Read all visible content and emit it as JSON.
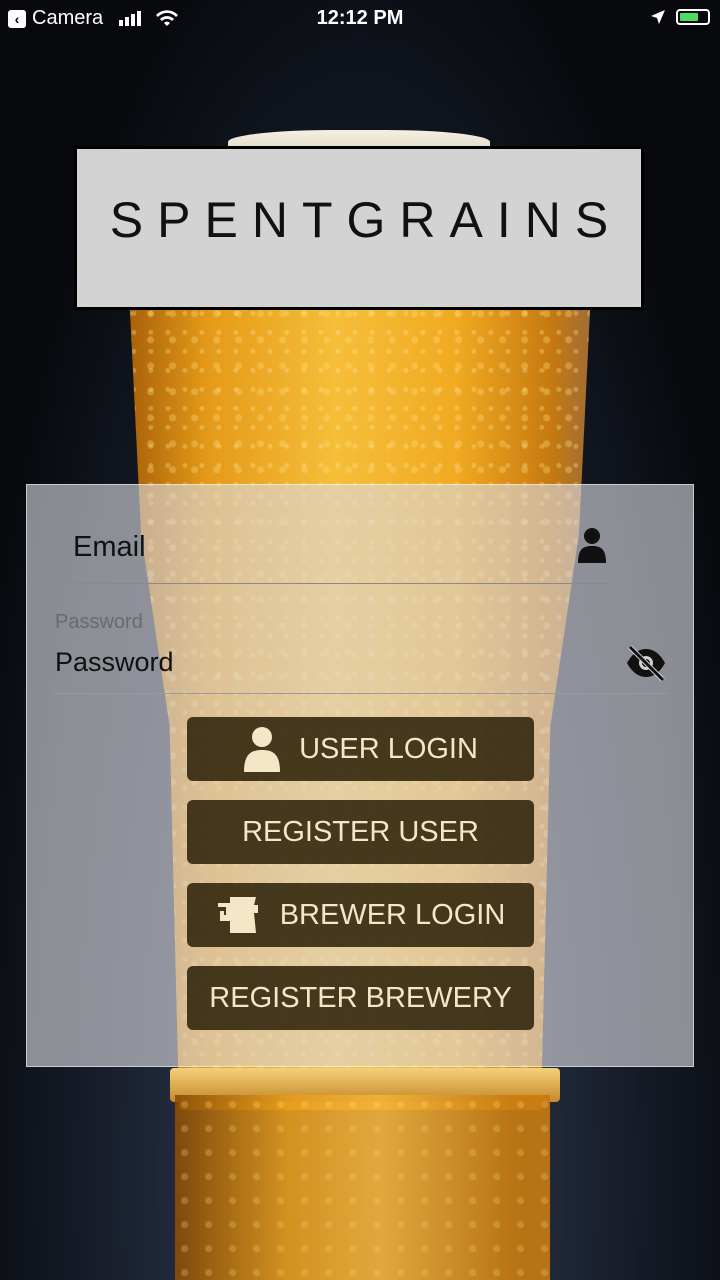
{
  "status_bar": {
    "back_app": "Camera",
    "time": "12:12 PM",
    "icons": [
      "back-icon",
      "signal-icon",
      "wifi-icon",
      "location-icon",
      "battery-icon"
    ]
  },
  "logo": {
    "text": "SPENTGRAINS"
  },
  "form": {
    "email_placeholder": "Email",
    "password_label": "Password",
    "password_placeholder": "Password"
  },
  "buttons": {
    "user_login": "USER LOGIN",
    "register_user": "REGISTER USER",
    "brewer_login": "BREWER LOGIN",
    "register_brewery": "REGISTER BREWERY"
  },
  "colors": {
    "button_bg": "#2b1f08",
    "button_text": "#f4e7c8",
    "panel_bg": "#dadae0",
    "battery": "#4cd964"
  }
}
